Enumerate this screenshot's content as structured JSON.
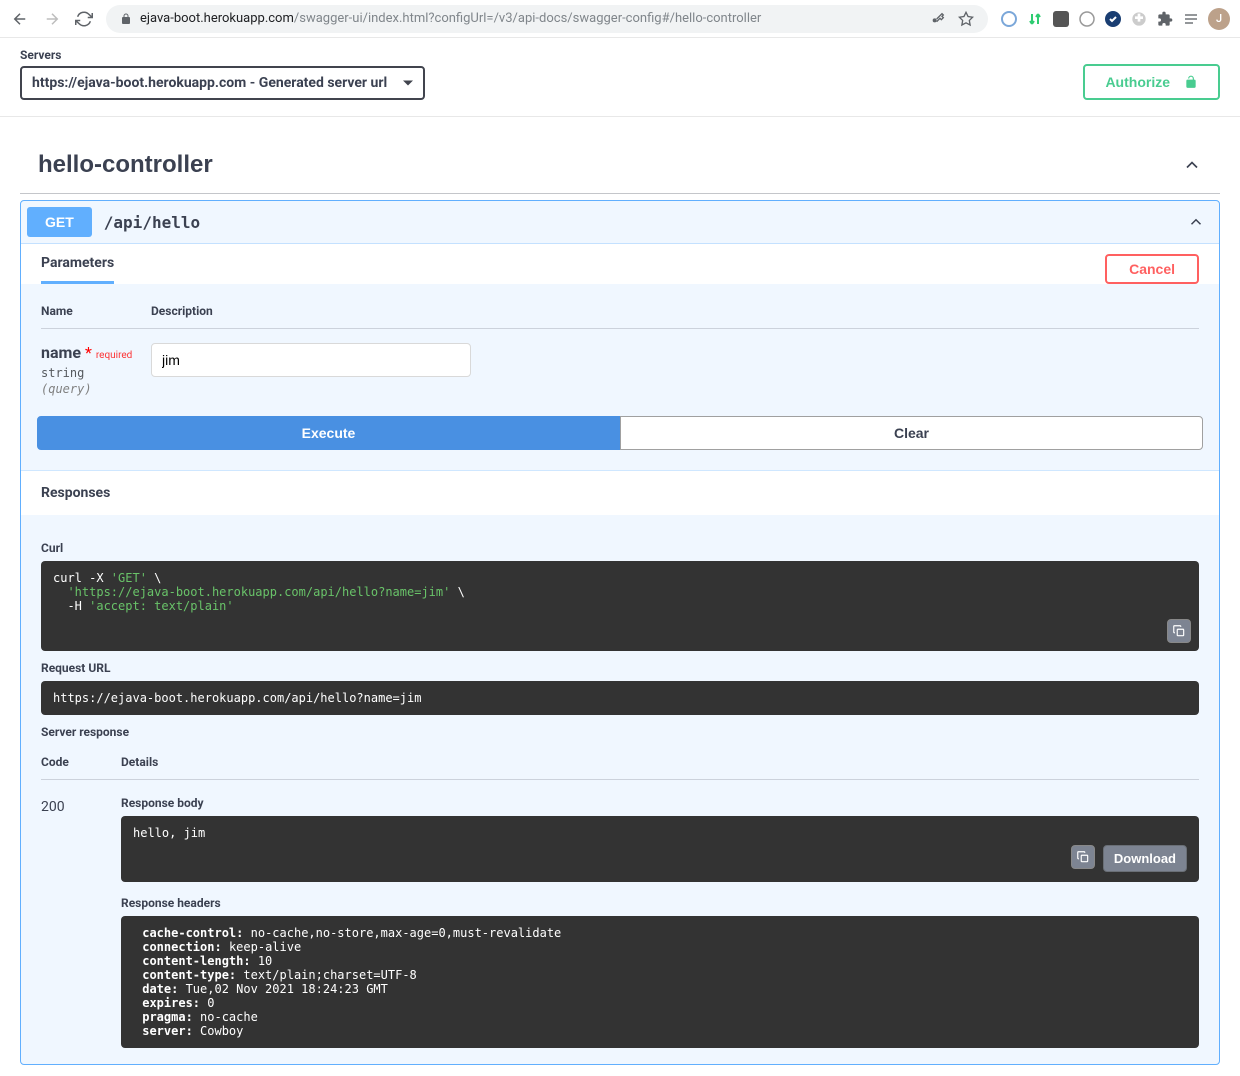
{
  "browser": {
    "url_host": "ejava-boot.herokuapp.com",
    "url_path": "/swagger-ui/index.html?configUrl=/v3/api-docs/swagger-config#/hello-controller",
    "avatar_letter": "J"
  },
  "servers": {
    "label": "Servers",
    "selected": "https://ejava-boot.herokuapp.com - Generated server url"
  },
  "authorize_label": "Authorize",
  "tag": "hello-controller",
  "operation": {
    "method": "GET",
    "path": "/api/hello"
  },
  "parameters": {
    "header": "Parameters",
    "cancel": "Cancel",
    "col_name": "Name",
    "col_desc": "Description",
    "param": {
      "name": "name",
      "required_label": "required",
      "type": "string",
      "in": "(query)",
      "value": "jim"
    }
  },
  "buttons": {
    "execute": "Execute",
    "clear": "Clear",
    "download": "Download"
  },
  "responses": {
    "header": "Responses",
    "curl_label": "Curl",
    "curl_prefix": "curl -X ",
    "curl_method": "'GET'",
    "curl_slash": " \\",
    "curl_url": "'https://ejava-boot.herokuapp.com/api/hello?name=jim'",
    "curl_h": "  -H ",
    "curl_accept": "'accept: text/plain'",
    "request_url_label": "Request URL",
    "request_url": "https://ejava-boot.herokuapp.com/api/hello?name=jim",
    "server_response_label": "Server response",
    "code_header": "Code",
    "details_header": "Details",
    "status": "200",
    "body_label": "Response body",
    "body": "hello, jim",
    "headers_label": "Response headers",
    "headers": [
      {
        "k": "cache-control:",
        "v": " no-cache,no-store,max-age=0,must-revalidate"
      },
      {
        "k": "connection:",
        "v": " keep-alive"
      },
      {
        "k": "content-length:",
        "v": " 10"
      },
      {
        "k": "content-type:",
        "v": " text/plain;charset=UTF-8"
      },
      {
        "k": "date:",
        "v": " Tue,02 Nov 2021 18:24:23 GMT"
      },
      {
        "k": "expires:",
        "v": " 0"
      },
      {
        "k": "pragma:",
        "v": " no-cache"
      },
      {
        "k": "server:",
        "v": " Cowboy"
      }
    ]
  }
}
